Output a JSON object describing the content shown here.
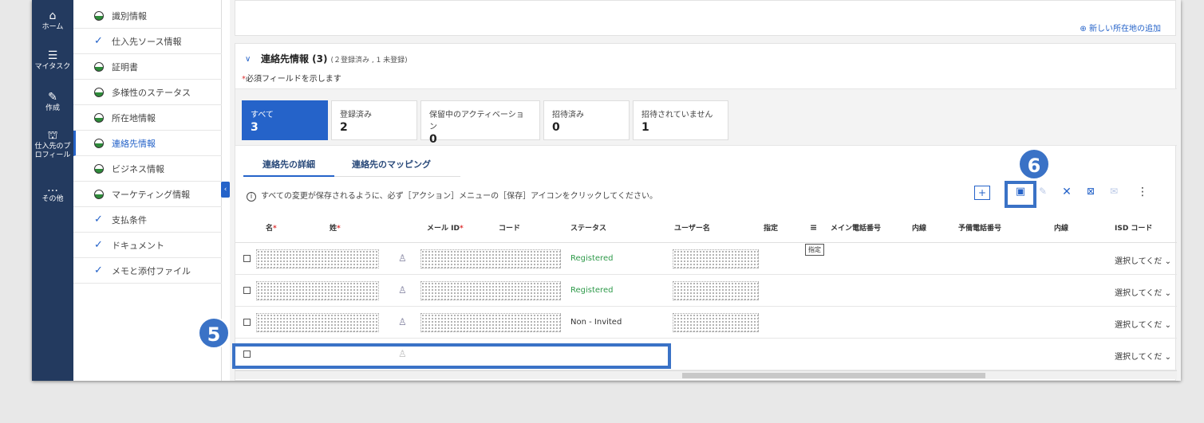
{
  "nav": [
    {
      "icon": "home-icon",
      "glyph": "⌂",
      "label": "ホーム"
    },
    {
      "icon": "list-icon",
      "glyph": "☰",
      "label": "マイタスク"
    },
    {
      "icon": "edit-icon",
      "glyph": "✎",
      "label": "作成"
    },
    {
      "icon": "org-icon",
      "glyph": "⛫",
      "label": "仕入先のプロフィール"
    },
    {
      "icon": "more-icon",
      "glyph": "…",
      "label": "その他"
    }
  ],
  "sections": [
    {
      "label": "識別情報",
      "status": "partial"
    },
    {
      "label": "仕入先ソース情報",
      "status": "done"
    },
    {
      "label": "証明書",
      "status": "partial"
    },
    {
      "label": "多様性のステータス",
      "status": "partial"
    },
    {
      "label": "所在地情報",
      "status": "partial"
    },
    {
      "label": "連絡先情報",
      "status": "partial",
      "active": true
    },
    {
      "label": "ビジネス情報",
      "status": "partial"
    },
    {
      "label": "マーケティング情報",
      "status": "partial"
    },
    {
      "label": "支払条件",
      "status": "done"
    },
    {
      "label": "ドキュメント",
      "status": "done"
    },
    {
      "label": "メモと添付ファイル",
      "status": "done"
    }
  ],
  "add_location": "新しい所在地の追加",
  "contact": {
    "title": "連絡先情報 (3)",
    "subtitle": "(２登録済み , 1 未登録)",
    "required_note": "必須フィールドを示します",
    "tiles": [
      {
        "label": "すべて",
        "count": "3",
        "selected": true
      },
      {
        "label": "登録済み",
        "count": "2"
      },
      {
        "label": "保留中のアクティベーション",
        "count": "0"
      },
      {
        "label": "招待済み",
        "count": "0"
      },
      {
        "label": "招待されていません",
        "count": "1"
      }
    ],
    "tabs": [
      "連絡先の詳細",
      "連絡先のマッピング"
    ],
    "info": "すべての変更が保存されるように、必ず［アクション］メニューの［保存］アイコンをクリックしてください。",
    "columns": {
      "first_name": "名",
      "last_name": "姓",
      "email": "メール ID",
      "code": "コード",
      "status": "ステータス",
      "username": "ユーザー名",
      "designate": "指定",
      "main_phone": "メイン電話番号",
      "ext1": "内線",
      "backup_phone": "予備電話番号",
      "ext2": "内線",
      "isd": "ISD コード"
    },
    "rows": [
      {
        "status": "Registered",
        "select": "選択してくだ"
      },
      {
        "status": "Registered",
        "select": "選択してくだ"
      },
      {
        "status": "Non - Invited",
        "select": "選択してくだ"
      },
      {
        "status": "",
        "select": "選択してくだ"
      }
    ],
    "tooltip": "指定"
  },
  "markers": [
    "5",
    "6"
  ],
  "colors": {
    "nav_bg": "#233a5f",
    "accent": "#2563c9",
    "registered": "#2e9a4a",
    "callout": "#3a72c6"
  }
}
